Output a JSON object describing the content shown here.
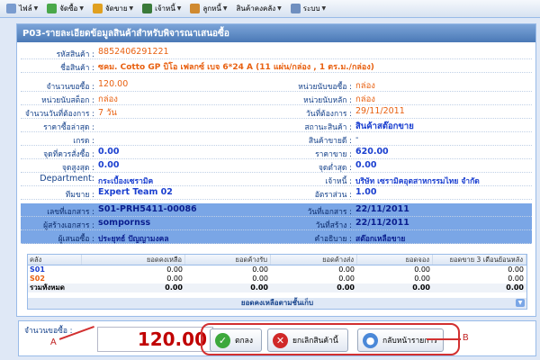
{
  "menu": [
    {
      "label": "ไฟล์",
      "icon": "file-icon",
      "color": "#7a9ccf"
    },
    {
      "label": "จัดซื้อ",
      "icon": "purchase-icon",
      "color": "#4aa84a"
    },
    {
      "label": "จัดขาย",
      "icon": "sales-icon",
      "color": "#e0a020"
    },
    {
      "label": "เจ้าหนี้",
      "icon": "creditor-icon",
      "color": "#3a7a3a"
    },
    {
      "label": "ลูกหนี้",
      "icon": "debtor-icon",
      "color": "#d08a30"
    },
    {
      "label": "สินค้าคงคลัง",
      "icon": "",
      "color": ""
    },
    {
      "label": "ระบบ",
      "icon": "system-icon",
      "color": "#6f8fbf"
    }
  ],
  "panel": {
    "title": "P03-รายละเอียดข้อมูลสินค้าสำหรับพิจารณาเสนอซื้อ"
  },
  "detail": {
    "product_code_label": "รหัสสินค้า :",
    "product_code": "8852406291221",
    "product_name_label": "ชื่อสินค้า :",
    "product_name": "ซคม. Cotto GP บิโอ เฟลกซ์ เบจ 6*24 A (11 แผ่น/กล่อง , 1 ตร.ม./กล่อง)",
    "order_qty_label": "จำนวนขอซื้อ :",
    "order_qty": "120.00",
    "stock_unit_label": "หน่วยนับสต็อก :",
    "stock_unit": "กล่อง",
    "days_needed_label": "จำนวนวันที่ต้องการ :",
    "days_needed": "7 วัน",
    "latest_cost_label": "ราคาซื้อล่าสุด :",
    "latest_cost": "",
    "grade_label": "เกรด :",
    "grade": "",
    "reorder_point_label": "จุดที่ควรสั่งซื้อ :",
    "reorder_point": "0.00",
    "max_point_label": "จุดสูงสุด :",
    "max_point": "0.00",
    "department_label": "Department:",
    "department": "กระเบื้องเซรามิค",
    "team_label": "ทีมขาย :",
    "team": "Expert Team 02",
    "doc_no_label": "เลขที่เอกสาร :",
    "doc_no": "S01-PRH5411-00086",
    "creator_label": "ผู้สร้างเอกสาร :",
    "creator": "sompornss",
    "requester_label": "ผู้เสนอซื้อ :",
    "requester": "ประยุทธ์ ปัญญามงคล",
    "request_unit_label": "หน่วยนับขอซื้อ :",
    "request_unit": "กล่อง",
    "main_unit_label": "หน่วยนับหลัก :",
    "main_unit": "กล่อง",
    "date_needed_label": "วันที่ต้องการ :",
    "date_needed": "29/11/2011",
    "status_label": "สถานะสินค้า :",
    "status": "สินค้าสต๊อกขาย",
    "last_sold_label": "สินค้าขายดี :",
    "last_sold": "-",
    "sale_price_label": "ราคาขาย :",
    "sale_price": "620.00",
    "min_point_label": "จุดต่ำสุด :",
    "min_point": "0.00",
    "supplier_label": "เจ้าหนี้ :",
    "supplier": "บริษัท เซรามิคอุตสาหกรรมไทย จำกัด",
    "ratio_label": "อัตราส่วน :",
    "ratio": "1.00",
    "doc_date_label": "วันที่เอกสาร :",
    "doc_date": "22/11/2011",
    "created_date_label": "วันที่สร้าง :",
    "created_date": "22/11/2011",
    "description_label": "คำอธิบาย :",
    "description": "สต๊อกเหลือขาย"
  },
  "grid": {
    "headers": [
      "คลัง",
      "ยอดคงเหลือ",
      "ยอดค้างรับ",
      "ยอดค้างส่ง",
      "ยอดจอง",
      "ยอดขาย 3 เดือนย้อนหลัง"
    ],
    "rows": [
      {
        "cells": [
          "S01",
          "0.00",
          "0.00",
          "0.00",
          "0.00",
          "0.00"
        ],
        "color": "#1a3fd0"
      },
      {
        "cells": [
          "S02",
          "0.00",
          "0.00",
          "0.00",
          "0.00",
          "0.00"
        ],
        "color": "#e86010"
      }
    ],
    "total": [
      "รวมทั้งหมด",
      "0.00",
      "0.00",
      "0.00",
      "0.00",
      "0.00"
    ],
    "footer": "ยอดคงเหลือตามชั้นเก็บ"
  },
  "bottom": {
    "qty_label": "จำนวนขอซื้อ :",
    "qty_value": "120.00",
    "ok_label": "ตกลง",
    "cancel_label": "ยกเลิกสินค้านี้",
    "back_label": "กลับหน้ารายการ"
  },
  "annotations": {
    "a": "A",
    "b": "B"
  }
}
